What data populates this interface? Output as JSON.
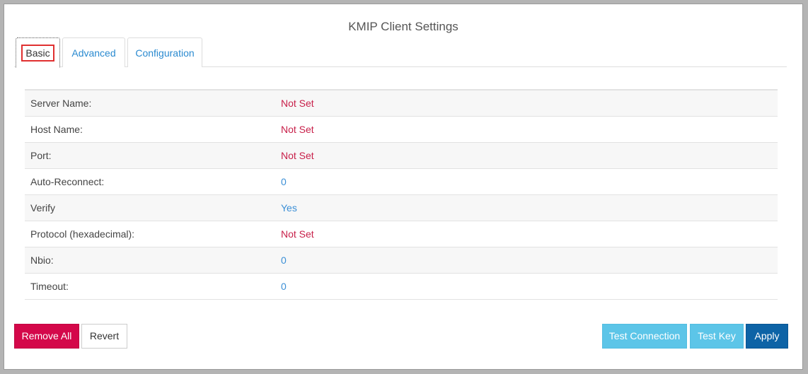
{
  "header": {
    "title": "KMIP Client Settings"
  },
  "tabs": [
    {
      "label": "Basic"
    },
    {
      "label": "Advanced"
    },
    {
      "label": "Configuration"
    }
  ],
  "settings": [
    {
      "label": "Server Name:",
      "value": "Not Set",
      "color": "#c8204a"
    },
    {
      "label": "Host Name:",
      "value": "Not Set",
      "color": "#c8204a"
    },
    {
      "label": "Port:",
      "value": "Not Set",
      "color": "#c8204a"
    },
    {
      "label": "Auto-Reconnect:",
      "value": "0",
      "color": "#3b8fd6"
    },
    {
      "label": "Verify",
      "value": "Yes",
      "color": "#3b8fd6"
    },
    {
      "label": "Protocol (hexadecimal):",
      "value": "Not Set",
      "color": "#c8204a"
    },
    {
      "label": "Nbio:",
      "value": "0",
      "color": "#3b8fd6"
    },
    {
      "label": "Timeout:",
      "value": "0",
      "color": "#3b8fd6"
    }
  ],
  "buttons": {
    "remove_all": "Remove All",
    "revert": "Revert",
    "test_connection": "Test Connection",
    "test_key": "Test Key",
    "apply": "Apply"
  }
}
